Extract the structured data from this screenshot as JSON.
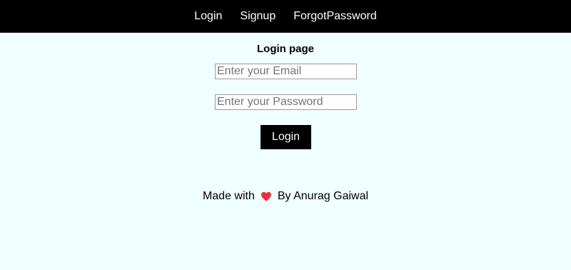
{
  "nav": {
    "items": [
      {
        "label": "Login"
      },
      {
        "label": "Signup"
      },
      {
        "label": "ForgotPassword"
      }
    ]
  },
  "login": {
    "title": "Login page",
    "email_placeholder": "Enter your Email",
    "email_value": "",
    "password_placeholder": "Enter your Password",
    "password_value": "",
    "button_label": "Login"
  },
  "footer": {
    "made_with": "Made with",
    "heart_icon": "heart-icon",
    "by": "By Anurag Gaiwal"
  },
  "colors": {
    "navbar_bg": "#000000",
    "page_bg": "#f0ffff",
    "button_bg": "#000000",
    "heart": "#e8303a"
  }
}
